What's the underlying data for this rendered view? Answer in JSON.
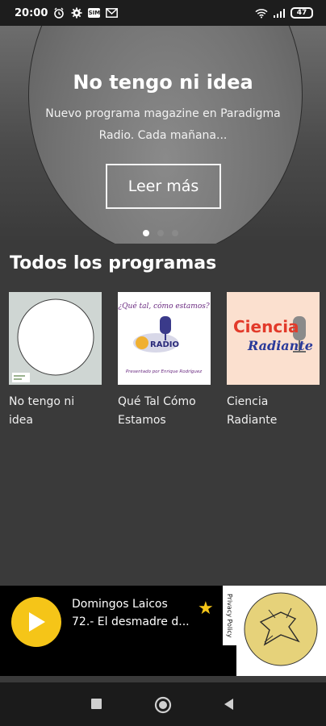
{
  "status": {
    "time": "20:00",
    "battery": "47",
    "notif_box": "SIM"
  },
  "hero": {
    "title": "No tengo ni idea",
    "description": "Nuevo programa magazine en Paradigma Radio. Cada mañana...",
    "button_label": "Leer más",
    "dots": 3,
    "active_dot": 0
  },
  "section": {
    "title": "Todos los programas"
  },
  "programs": [
    {
      "label": "No tengo ni idea",
      "thumb_small_text": "tengo idea"
    },
    {
      "label": "Qué Tal Cómo Estamos",
      "thumb_script": "¿Qué tal, cómo estamos?",
      "thumb_logo": "RADIO",
      "thumb_caption": "Presentado por Enrique Rodríguez"
    },
    {
      "label": "Ciencia Radiante",
      "thumb_word1": "Ciencia",
      "thumb_word2": "Radiante"
    }
  ],
  "player": {
    "title": "Domingos Laicos",
    "subtitle": "72.- El desmadre d...",
    "privacy_label": "Privacy Policy"
  },
  "colors": {
    "accent": "#f5c518",
    "background": "#3a3a3a",
    "player_bg": "#000000"
  },
  "icons": [
    "alarm-icon",
    "settings-icon",
    "email-icon",
    "wifi-icon",
    "signal-icon",
    "battery-icon",
    "play-icon",
    "star-icon",
    "square-icon",
    "circle-icon",
    "back-icon"
  ]
}
